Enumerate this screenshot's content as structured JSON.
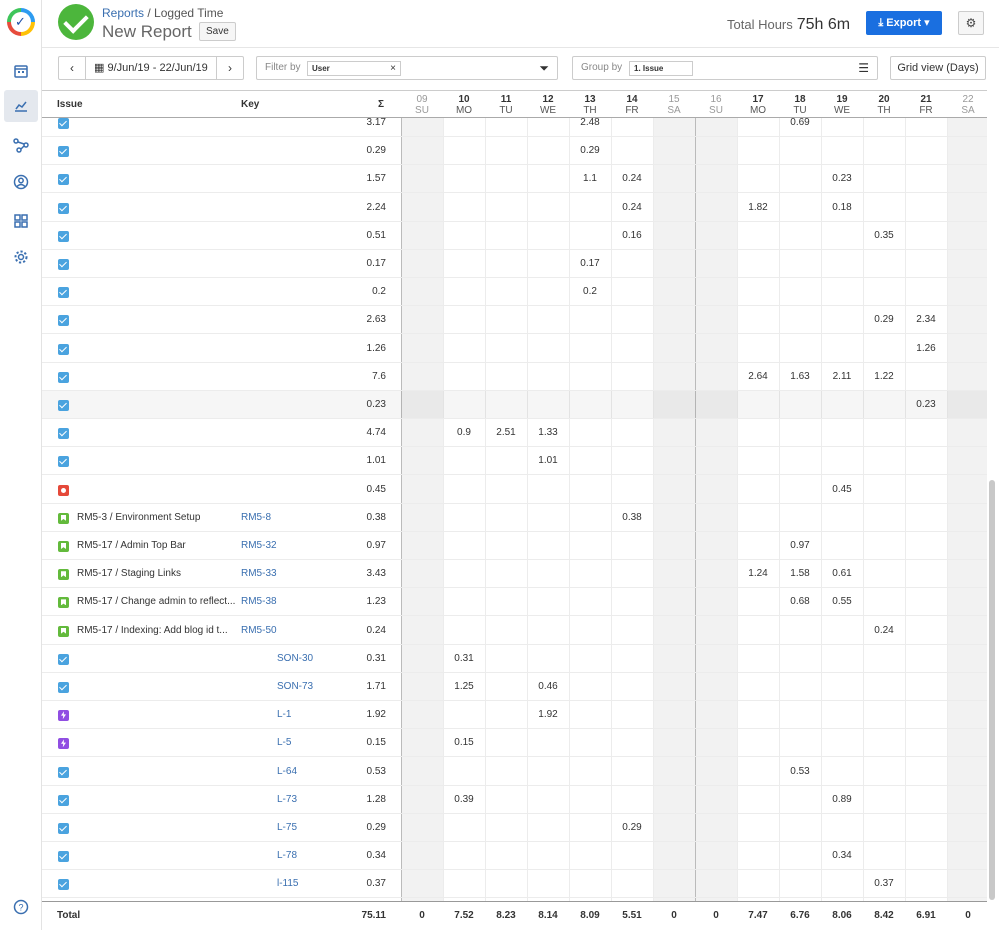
{
  "nav": {
    "items": [
      "calendar-icon",
      "chart-icon",
      "flow-icon",
      "user-circle-icon",
      "apps-icon",
      "gear-icon"
    ],
    "help": "?"
  },
  "header": {
    "breadcrumb_link": "Reports",
    "breadcrumb_rest": "/ Logged Time",
    "title": "New Report",
    "save_label": "Save",
    "total_hours_label": "Total Hours",
    "total_hours_value": "75h 6m",
    "export_label": "Export",
    "settings_icon": "⚙"
  },
  "toolbar": {
    "date_range": "9/Jun/19 - 22/Jun/19",
    "filter_label": "Filter by",
    "filter_tag": "User",
    "filter_tag_remove": "×",
    "groupby_label": "Group by",
    "groupby_tag": "1. Issue",
    "view_label": "Grid view (Days)"
  },
  "columns": {
    "issue": "Issue",
    "key": "Key",
    "sum": "Σ",
    "days": [
      {
        "n": "09",
        "d": "SU",
        "we": true
      },
      {
        "n": "10",
        "d": "MO",
        "we": false
      },
      {
        "n": "11",
        "d": "TU",
        "we": false
      },
      {
        "n": "12",
        "d": "WE",
        "we": false
      },
      {
        "n": "13",
        "d": "TH",
        "we": false
      },
      {
        "n": "14",
        "d": "FR",
        "we": false
      },
      {
        "n": "15",
        "d": "SA",
        "we": true
      },
      {
        "n": "16",
        "d": "SU",
        "we": true
      },
      {
        "n": "17",
        "d": "MO",
        "we": false
      },
      {
        "n": "18",
        "d": "TU",
        "we": false
      },
      {
        "n": "19",
        "d": "WE",
        "we": false
      },
      {
        "n": "20",
        "d": "TH",
        "we": false
      },
      {
        "n": "21",
        "d": "FR",
        "we": false
      },
      {
        "n": "22",
        "d": "SA",
        "we": true
      }
    ]
  },
  "rows": [
    {
      "type": "task",
      "issue": "",
      "key": "",
      "keyIndent": false,
      "sum": "3.17",
      "vals": [
        "",
        "",
        "",
        "",
        "2.48",
        "",
        "",
        "",
        "",
        "0.69",
        "",
        "",
        "",
        ""
      ]
    },
    {
      "type": "task",
      "issue": "",
      "key": "",
      "keyIndent": false,
      "sum": "0.29",
      "vals": [
        "",
        "",
        "",
        "",
        "0.29",
        "",
        "",
        "",
        "",
        "",
        "",
        "",
        "",
        ""
      ]
    },
    {
      "type": "task",
      "issue": "",
      "key": "",
      "keyIndent": false,
      "sum": "1.57",
      "vals": [
        "",
        "",
        "",
        "",
        "1.1",
        "0.24",
        "",
        "",
        "",
        "",
        "0.23",
        "",
        "",
        ""
      ]
    },
    {
      "type": "task",
      "issue": "",
      "key": "",
      "keyIndent": false,
      "sum": "2.24",
      "vals": [
        "",
        "",
        "",
        "",
        "",
        "0.24",
        "",
        "",
        "1.82",
        "",
        "0.18",
        "",
        "",
        ""
      ]
    },
    {
      "type": "task",
      "issue": "",
      "key": "",
      "keyIndent": false,
      "sum": "0.51",
      "vals": [
        "",
        "",
        "",
        "",
        "",
        "0.16",
        "",
        "",
        "",
        "",
        "",
        "0.35",
        "",
        ""
      ]
    },
    {
      "type": "task",
      "issue": "",
      "key": "",
      "keyIndent": false,
      "sum": "0.17",
      "vals": [
        "",
        "",
        "",
        "",
        "0.17",
        "",
        "",
        "",
        "",
        "",
        "",
        "",
        "",
        ""
      ]
    },
    {
      "type": "task",
      "issue": "",
      "key": "",
      "keyIndent": false,
      "sum": "0.2",
      "vals": [
        "",
        "",
        "",
        "",
        "0.2",
        "",
        "",
        "",
        "",
        "",
        "",
        "",
        "",
        ""
      ]
    },
    {
      "type": "task",
      "issue": "",
      "key": "",
      "keyIndent": false,
      "sum": "2.63",
      "vals": [
        "",
        "",
        "",
        "",
        "",
        "",
        "",
        "",
        "",
        "",
        "",
        "0.29",
        "2.34",
        ""
      ]
    },
    {
      "type": "task",
      "issue": "",
      "key": "",
      "keyIndent": false,
      "sum": "1.26",
      "vals": [
        "",
        "",
        "",
        "",
        "",
        "",
        "",
        "",
        "",
        "",
        "",
        "",
        "1.26",
        ""
      ]
    },
    {
      "type": "task",
      "issue": "",
      "key": "",
      "keyIndent": false,
      "sum": "7.6",
      "vals": [
        "",
        "",
        "",
        "",
        "",
        "",
        "",
        "",
        "2.64",
        "1.63",
        "2.11",
        "1.22",
        "",
        ""
      ]
    },
    {
      "type": "task",
      "issue": "",
      "key": "",
      "keyIndent": false,
      "sum": "0.23",
      "hl": true,
      "vals": [
        "",
        "",
        "",
        "",
        "",
        "",
        "",
        "",
        "",
        "",
        "",
        "",
        "0.23",
        ""
      ]
    },
    {
      "type": "task",
      "issue": "",
      "key": "",
      "keyIndent": false,
      "sum": "4.74",
      "vals": [
        "",
        "0.9",
        "2.51",
        "1.33",
        "",
        "",
        "",
        "",
        "",
        "",
        "",
        "",
        "",
        ""
      ]
    },
    {
      "type": "task",
      "issue": "",
      "key": "",
      "keyIndent": false,
      "sum": "1.01",
      "vals": [
        "",
        "",
        "",
        "1.01",
        "",
        "",
        "",
        "",
        "",
        "",
        "",
        "",
        "",
        ""
      ]
    },
    {
      "type": "bug",
      "issue": "",
      "key": "",
      "keyIndent": false,
      "sum": "0.45",
      "vals": [
        "",
        "",
        "",
        "",
        "",
        "",
        "",
        "",
        "",
        "",
        "0.45",
        "",
        "",
        ""
      ]
    },
    {
      "type": "story",
      "issue": "RM5-3 / Environment Setup",
      "key": "RM5-8",
      "keyIndent": false,
      "sum": "0.38",
      "vals": [
        "",
        "",
        "",
        "",
        "",
        "0.38",
        "",
        "",
        "",
        "",
        "",
        "",
        "",
        ""
      ]
    },
    {
      "type": "story",
      "issue": "RM5-17 / Admin Top Bar",
      "key": "RM5-32",
      "keyIndent": false,
      "sum": "0.97",
      "vals": [
        "",
        "",
        "",
        "",
        "",
        "",
        "",
        "",
        "",
        "0.97",
        "",
        "",
        "",
        ""
      ]
    },
    {
      "type": "story",
      "issue": "RM5-17 / Staging Links",
      "key": "RM5-33",
      "keyIndent": false,
      "sum": "3.43",
      "vals": [
        "",
        "",
        "",
        "",
        "",
        "",
        "",
        "",
        "1.24",
        "1.58",
        "0.61",
        "",
        "",
        ""
      ]
    },
    {
      "type": "story",
      "issue": "RM5-17 / Change admin to reflect...",
      "key": "RM5-38",
      "keyIndent": false,
      "sum": "1.23",
      "vals": [
        "",
        "",
        "",
        "",
        "",
        "",
        "",
        "",
        "",
        "0.68",
        "0.55",
        "",
        "",
        ""
      ]
    },
    {
      "type": "story",
      "issue": "RM5-17 / Indexing: Add blog id t...",
      "key": "RM5-50",
      "keyIndent": false,
      "sum": "0.24",
      "vals": [
        "",
        "",
        "",
        "",
        "",
        "",
        "",
        "",
        "",
        "",
        "",
        "0.24",
        "",
        ""
      ]
    },
    {
      "type": "task",
      "issue": "",
      "key": "SON-30",
      "keyIndent": true,
      "sum": "0.31",
      "vals": [
        "",
        "0.31",
        "",
        "",
        "",
        "",
        "",
        "",
        "",
        "",
        "",
        "",
        "",
        ""
      ]
    },
    {
      "type": "task",
      "issue": "",
      "key": "SON-73",
      "keyIndent": true,
      "sum": "1.71",
      "vals": [
        "",
        "1.25",
        "",
        "0.46",
        "",
        "",
        "",
        "",
        "",
        "",
        "",
        "",
        "",
        ""
      ]
    },
    {
      "type": "epic",
      "issue": "",
      "key": "L-1",
      "keyIndent": true,
      "sum": "1.92",
      "vals": [
        "",
        "",
        "",
        "1.92",
        "",
        "",
        "",
        "",
        "",
        "",
        "",
        "",
        "",
        ""
      ]
    },
    {
      "type": "epic",
      "issue": "",
      "key": "L-5",
      "keyIndent": true,
      "sum": "0.15",
      "vals": [
        "",
        "0.15",
        "",
        "",
        "",
        "",
        "",
        "",
        "",
        "",
        "",
        "",
        "",
        ""
      ]
    },
    {
      "type": "task",
      "issue": "",
      "key": "L-64",
      "keyIndent": true,
      "sum": "0.53",
      "vals": [
        "",
        "",
        "",
        "",
        "",
        "",
        "",
        "",
        "",
        "0.53",
        "",
        "",
        "",
        ""
      ]
    },
    {
      "type": "task",
      "issue": "",
      "key": "L-73",
      "keyIndent": true,
      "sum": "1.28",
      "vals": [
        "",
        "0.39",
        "",
        "",
        "",
        "",
        "",
        "",
        "",
        "",
        "0.89",
        "",
        "",
        ""
      ]
    },
    {
      "type": "task",
      "issue": "",
      "key": "L-75",
      "keyIndent": true,
      "sum": "0.29",
      "vals": [
        "",
        "",
        "",
        "",
        "",
        "0.29",
        "",
        "",
        "",
        "",
        "",
        "",
        "",
        ""
      ]
    },
    {
      "type": "task",
      "issue": "",
      "key": "L-78",
      "keyIndent": true,
      "sum": "0.34",
      "vals": [
        "",
        "",
        "",
        "",
        "",
        "",
        "",
        "",
        "",
        "",
        "0.34",
        "",
        "",
        ""
      ]
    },
    {
      "type": "task",
      "issue": "",
      "key": "l-115",
      "keyIndent": true,
      "sum": "0.37",
      "vals": [
        "",
        "",
        "",
        "",
        "",
        "",
        "",
        "",
        "",
        "",
        "",
        "0.37",
        "",
        ""
      ]
    }
  ],
  "totals": {
    "label": "Total",
    "sum": "75.11",
    "vals": [
      "0",
      "7.52",
      "8.23",
      "8.14",
      "8.09",
      "5.51",
      "0",
      "0",
      "7.47",
      "6.76",
      "8.06",
      "8.42",
      "6.91",
      "0"
    ]
  },
  "colors": {
    "accent": "#1a6fe0",
    "success": "#4cb63c",
    "task": "#4aa3df",
    "bug": "#e5493a",
    "story": "#63ba3c",
    "epic": "#904ee2"
  }
}
